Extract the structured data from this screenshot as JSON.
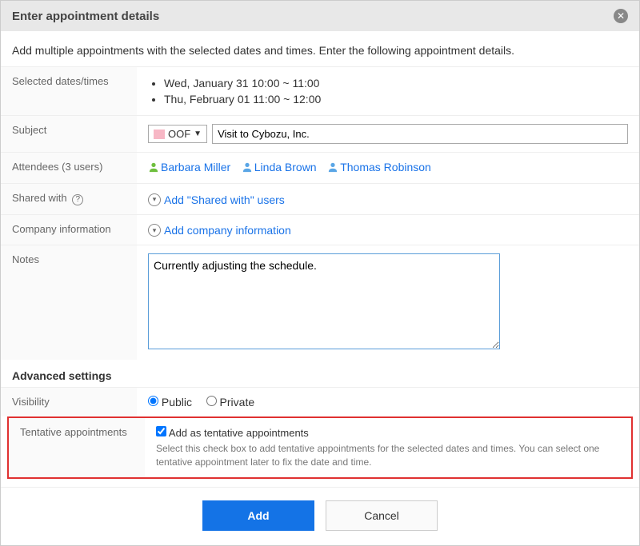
{
  "header": {
    "title": "Enter appointment details"
  },
  "intro": "Add multiple appointments with the selected dates and times. Enter the following appointment details.",
  "labels": {
    "selected": "Selected dates/times",
    "subject": "Subject",
    "attendees": "Attendees (3 users)",
    "shared": "Shared with",
    "company": "Company information",
    "notes": "Notes",
    "advanced": "Advanced settings",
    "visibility": "Visibility",
    "tentative": "Tentative appointments"
  },
  "dates": [
    "Wed, January 31 10:00 ~ 11:00",
    "Thu, February 01 11:00 ~ 12:00"
  ],
  "subject": {
    "type": "OOF",
    "value": "Visit to Cybozu, Inc."
  },
  "attendees": [
    {
      "name": "Barbara Miller",
      "color": "#6fbf3e"
    },
    {
      "name": "Linda Brown",
      "color": "#5aa6e6"
    },
    {
      "name": "Thomas Robinson",
      "color": "#5aa6e6"
    }
  ],
  "actions": {
    "sharedAdd": "Add \"Shared with\" users",
    "companyAdd": "Add company information"
  },
  "notes": "Currently adjusting the schedule.",
  "visibility": {
    "public": "Public",
    "private": "Private",
    "selected": "public"
  },
  "tentative": {
    "checkboxLabel": "Add as tentative appointments",
    "checked": true,
    "desc": "Select this check box to add tentative appointments for the selected dates and times. You can select one tentative appointment later to fix the date and time."
  },
  "footer": {
    "add": "Add",
    "cancel": "Cancel"
  }
}
